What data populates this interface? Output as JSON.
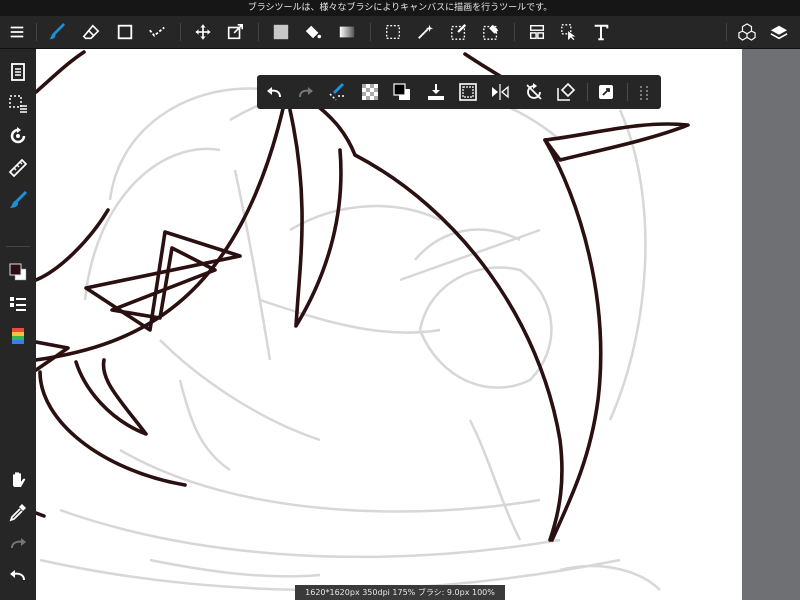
{
  "hint": {
    "text": "ブラシツールは、様々なブラシによりキャンバスに描画を行うツールです。"
  },
  "status": {
    "text": "1620*1620px 350dpi 175% ブラシ: 9.0px 100%"
  },
  "colors": {
    "accent": "#1e90d6",
    "primary_color": "#2a1010",
    "secondary_color": "#ffffff",
    "right_pane": "#6e7073"
  },
  "toolbar": {
    "left": [
      "menu-icon",
      "brush-icon",
      "eraser-icon",
      "rect-shape-icon",
      "correction-icon",
      "move-icon",
      "transform-icon",
      "fill-color-icon",
      "bucket-icon",
      "gradient-icon",
      "select-rect-icon",
      "magic-wand-icon",
      "select-pen-icon",
      "select-eraser-icon",
      "frame-icon",
      "operation-icon",
      "text-icon"
    ],
    "right": [
      "material-icon",
      "layer-icon"
    ]
  },
  "sidebar": {
    "items": [
      "page-icon",
      "selection-icon",
      "rotate-icon",
      "ruler-icon",
      "brush-icon",
      "color-icon",
      "brush-list-icon",
      "palette-icon",
      "hand-icon",
      "eyedropper-icon",
      "redo-icon",
      "undo-icon"
    ]
  },
  "float_bar": {
    "items": [
      "undo-icon",
      "redo-icon",
      "snap-icon",
      "transparent-icon",
      "swap-color-icon",
      "import-icon",
      "select-all-icon",
      "flip-icon",
      "rotate-reset-icon",
      "eraser-select-icon",
      "expand-icon",
      "more-icon"
    ]
  }
}
